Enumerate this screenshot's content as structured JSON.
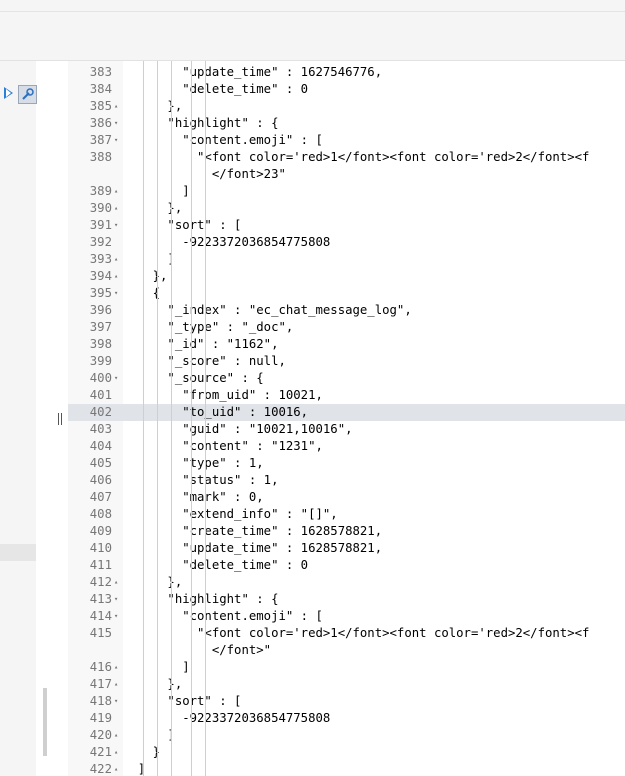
{
  "editor": {
    "lines": [
      {
        "n": "383",
        "f": "",
        "t": "        \"update_time\" : 1627546776,"
      },
      {
        "n": "384",
        "f": "",
        "t": "        \"delete_time\" : 0"
      },
      {
        "n": "385",
        "f": "▴",
        "t": "      },"
      },
      {
        "n": "386",
        "f": "▾",
        "t": "      \"highlight\" : {"
      },
      {
        "n": "387",
        "f": "▾",
        "t": "        \"content.emoji\" : ["
      },
      {
        "n": "388",
        "f": "",
        "t": "          \"<font color='red>1</font><font color='red>2</font><f"
      },
      {
        "n": "",
        "f": "",
        "t": "            </font>23\""
      },
      {
        "n": "389",
        "f": "▴",
        "t": "        ]"
      },
      {
        "n": "390",
        "f": "▴",
        "t": "      },"
      },
      {
        "n": "391",
        "f": "▾",
        "t": "      \"sort\" : ["
      },
      {
        "n": "392",
        "f": "",
        "t": "        -9223372036854775808"
      },
      {
        "n": "393",
        "f": "▴",
        "t": "      ]"
      },
      {
        "n": "394",
        "f": "▴",
        "t": "    },"
      },
      {
        "n": "395",
        "f": "▾",
        "t": "    {"
      },
      {
        "n": "396",
        "f": "",
        "t": "      \"_index\" : \"ec_chat_message_log\","
      },
      {
        "n": "397",
        "f": "",
        "t": "      \"_type\" : \"_doc\","
      },
      {
        "n": "398",
        "f": "",
        "t": "      \"_id\" : \"1162\","
      },
      {
        "n": "399",
        "f": "",
        "t": "      \"_score\" : null,"
      },
      {
        "n": "400",
        "f": "▾",
        "t": "      \"_source\" : {"
      },
      {
        "n": "401",
        "f": "",
        "t": "        \"from_uid\" : 10021,"
      },
      {
        "n": "402",
        "f": "",
        "t": "        \"to_uid\" : 10016,",
        "active": true
      },
      {
        "n": "403",
        "f": "",
        "t": "        \"guid\" : \"10021,10016\","
      },
      {
        "n": "404",
        "f": "",
        "t": "        \"content\" : \"1231\","
      },
      {
        "n": "405",
        "f": "",
        "t": "        \"type\" : 1,"
      },
      {
        "n": "406",
        "f": "",
        "t": "        \"status\" : 1,"
      },
      {
        "n": "407",
        "f": "",
        "t": "        \"mark\" : 0,"
      },
      {
        "n": "408",
        "f": "",
        "t": "        \"extend_info\" : \"[]\","
      },
      {
        "n": "409",
        "f": "",
        "t": "        \"create_time\" : 1628578821,"
      },
      {
        "n": "410",
        "f": "",
        "t": "        \"update_time\" : 1628578821,"
      },
      {
        "n": "411",
        "f": "",
        "t": "        \"delete_time\" : 0"
      },
      {
        "n": "412",
        "f": "▴",
        "t": "      },"
      },
      {
        "n": "413",
        "f": "▾",
        "t": "      \"highlight\" : {"
      },
      {
        "n": "414",
        "f": "▾",
        "t": "        \"content.emoji\" : ["
      },
      {
        "n": "415",
        "f": "",
        "t": "          \"<font color='red>1</font><font color='red>2</font><f"
      },
      {
        "n": "",
        "f": "",
        "t": "            </font>\""
      },
      {
        "n": "416",
        "f": "▴",
        "t": "        ]"
      },
      {
        "n": "417",
        "f": "▴",
        "t": "      },"
      },
      {
        "n": "418",
        "f": "▾",
        "t": "      \"sort\" : ["
      },
      {
        "n": "419",
        "f": "",
        "t": "        -9223372036854775808"
      },
      {
        "n": "420",
        "f": "▴",
        "t": "      ]"
      },
      {
        "n": "421",
        "f": "▴",
        "t": "    }"
      },
      {
        "n": "422",
        "f": "▴",
        "t": "  ]"
      }
    ]
  },
  "toolbar": {
    "run_icon": "play-icon",
    "settings_icon": "wrench-icon"
  }
}
